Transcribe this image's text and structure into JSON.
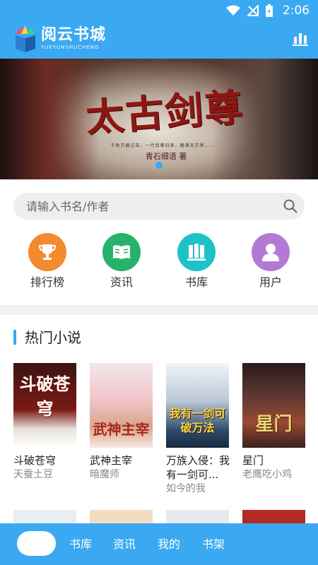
{
  "status": {
    "time": "2:06"
  },
  "header": {
    "brand_name": "阅云书城",
    "brand_sub": "YUEYUNSHUCHENG",
    "stats_icon": "bar-stats-icon"
  },
  "banner": {
    "title": "太古剑尊",
    "tagline": "千秋万载过去，一代剑尊归来，踏诸天万界……",
    "author": "青石细语 著"
  },
  "search": {
    "placeholder": "请输入书名/作者"
  },
  "quicknav": {
    "items": [
      {
        "label": "排行榜",
        "icon": "trophy-icon",
        "color": "#f28a2e"
      },
      {
        "label": "资讯",
        "icon": "book-open-icon",
        "color": "#27b26b"
      },
      {
        "label": "书库",
        "icon": "bookshelf-icon",
        "color": "#1fc1c9"
      },
      {
        "label": "用户",
        "icon": "user-icon",
        "color": "#b27ad6"
      }
    ]
  },
  "section": {
    "title": "热门小说"
  },
  "books": [
    {
      "title": "斗破苍穹",
      "author": "天蚕土豆",
      "cover_text": "斗破苍穹"
    },
    {
      "title": "武神主宰",
      "author": "暗魔师",
      "cover_text": "武神主宰"
    },
    {
      "title": "万族入侵：我有一剑可...",
      "author": "如今的我",
      "cover_text": "我有一剑可破万法"
    },
    {
      "title": "星门",
      "author": "老鹰吃小鸡",
      "cover_text": "星门"
    }
  ],
  "bottomnav": {
    "items": [
      {
        "label": "书库"
      },
      {
        "label": "资讯"
      },
      {
        "label": "我的"
      },
      {
        "label": "书架"
      }
    ]
  },
  "colors": {
    "primary": "#3aa9f2"
  }
}
